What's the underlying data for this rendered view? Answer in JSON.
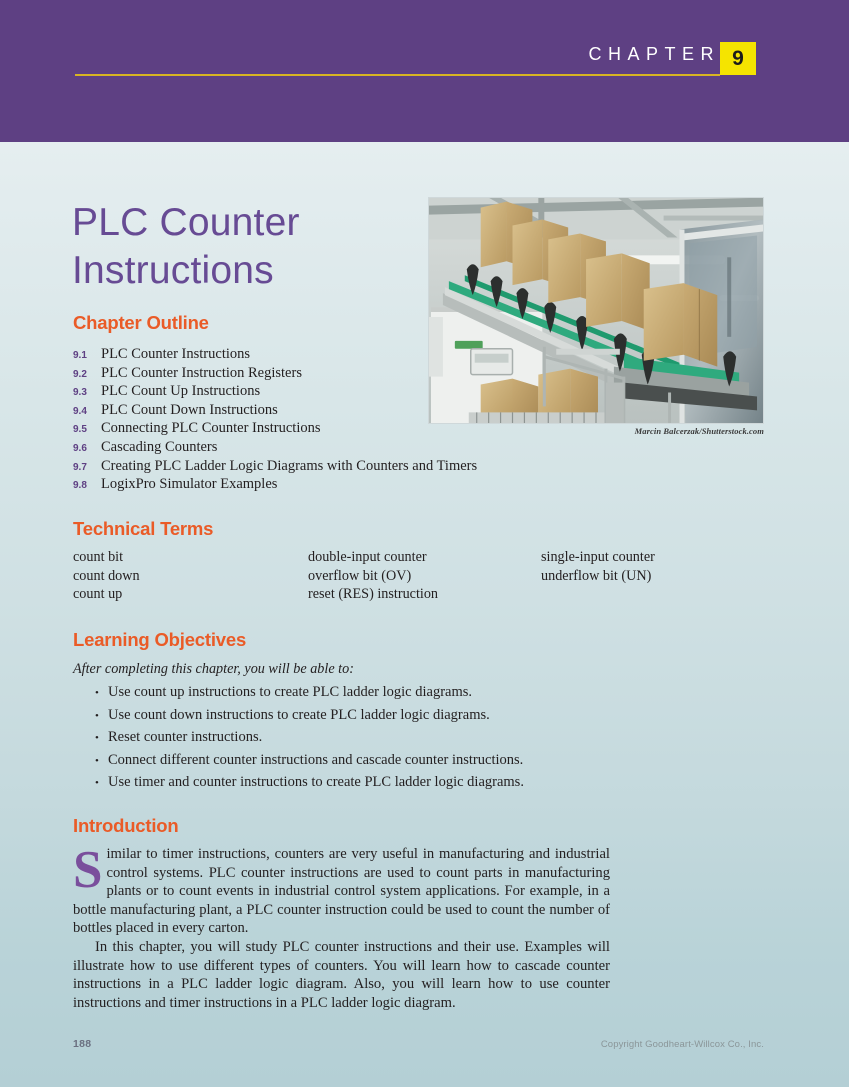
{
  "header": {
    "chapter_word": "CHAPTER",
    "chapter_number": "9",
    "band_color": "#5E4083",
    "rule_color": "#D8B422",
    "number_box_color": "#F5E400"
  },
  "title": {
    "line1": "PLC Counter",
    "line2": "Instructions",
    "color": "#674B94"
  },
  "photo": {
    "alt": "Cardboard boxes traveling on an inclined green conveyor belt inside a packaging plant",
    "credit": "Marcin Balcerzak/Shutterstock.com"
  },
  "sections": {
    "outline_heading": "Chapter Outline",
    "terms_heading": "Technical Terms",
    "objectives_heading": "Learning Objectives",
    "intro_heading": "Introduction",
    "heading_color": "#EA5B27"
  },
  "outline": [
    {
      "num": "9.1",
      "text": "PLC Counter Instructions"
    },
    {
      "num": "9.2",
      "text": "PLC Counter Instruction Registers"
    },
    {
      "num": "9.3",
      "text": "PLC Count Up Instructions"
    },
    {
      "num": "9.4",
      "text": "PLC Count Down Instructions"
    },
    {
      "num": "9.5",
      "text": "Connecting PLC Counter Instructions"
    },
    {
      "num": "9.6",
      "text": "Cascading Counters"
    },
    {
      "num": "9.7",
      "text": "Creating PLC Ladder Logic Diagrams with Counters and Timers"
    },
    {
      "num": "9.8",
      "text": "LogixPro Simulator Examples"
    }
  ],
  "technical_terms": {
    "rows": [
      {
        "c1": "count bit",
        "c2": "double-input counter",
        "c3": "single-input counter"
      },
      {
        "c1": "count down",
        "c2": "overflow bit (OV)",
        "c3": "underflow bit (UN)"
      },
      {
        "c1": "count up",
        "c2": "reset (RES) instruction",
        "c3": ""
      }
    ]
  },
  "objectives": {
    "intro": "After completing this chapter, you will be able to:",
    "bullet_glyph": "•",
    "items": [
      "Use count up instructions to create PLC ladder logic diagrams.",
      "Use count down instructions to create PLC ladder logic diagrams.",
      "Reset counter instructions.",
      "Connect different counter instructions and cascade counter instructions.",
      "Use timer and counter instructions to create PLC ladder logic diagrams."
    ]
  },
  "introduction": {
    "paragraph1": "Similar to timer instructions, counters are very useful in manufacturing and industrial control systems. PLC counter instructions are used to count parts in manufacturing plants or to count events in industrial control system applications. For example, in a bottle manufacturing plant, a PLC counter instruction could be used to count the number of bottles placed in every carton.",
    "paragraph2": "In this chapter, you will study PLC counter instructions and their use. Examples will illustrate how to use different types of counters. You will learn how to cascade counter instructions in a PLC ladder logic diagram. Also, you will learn how to use counter instructions and timer instructions in a PLC ladder logic diagram.",
    "dropcap_color": "#7A4F9C"
  },
  "footer": {
    "page_number": "188",
    "copyright": "Copyright Goodheart-Willcox Co., Inc."
  }
}
